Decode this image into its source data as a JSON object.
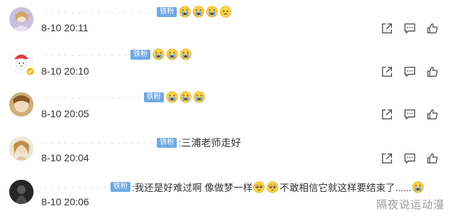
{
  "badge_label": "铁粉",
  "comments": [
    {
      "time": "8-10 20:11",
      "text": ""
    },
    {
      "time": "8-10 20:10",
      "text": ""
    },
    {
      "time": "8-10 20:05",
      "text": ""
    },
    {
      "time": "8-10 20:04",
      "text": ":三浦老师走好"
    },
    {
      "time": "8-10 20:06",
      "text_a": ":我还是好难过啊 像做梦一样",
      "text_b": "不敢相信它就这样要结束了......"
    }
  ],
  "watermark": "隔夜说运动漫",
  "icons": {
    "share": "share-icon",
    "comment": "comment-icon",
    "like": "thumbs-up-icon",
    "verified": "verified-badge-icon"
  },
  "colors": {
    "badge": "#6fa9e3",
    "emoji_face": "#ffd24d",
    "emoji_tear": "#6cb7ef",
    "icon_gray": "#555555"
  }
}
